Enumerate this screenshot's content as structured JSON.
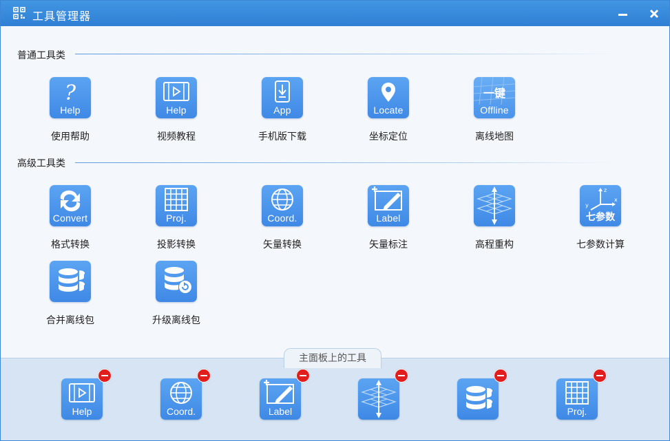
{
  "window": {
    "title": "工具管理器",
    "min_label": "–",
    "close_label": "✕"
  },
  "sections": {
    "common": {
      "title": "普通工具类"
    },
    "advanced": {
      "title": "高级工具类"
    }
  },
  "common_tools": [
    {
      "label": "使用帮助",
      "caption": "Help",
      "icon": "help-icon"
    },
    {
      "label": "视频教程",
      "caption": "Help",
      "icon": "video-icon"
    },
    {
      "label": "手机版下载",
      "caption": "App",
      "icon": "phone-download-icon"
    },
    {
      "label": "坐标定位",
      "caption": "Locate",
      "icon": "location-pin-icon"
    },
    {
      "label": "离线地图",
      "caption": "Offline",
      "icon": "offline-map-icon",
      "badge_text": "一键"
    }
  ],
  "advanced_tools": [
    {
      "label": "格式转换",
      "caption": "Convert",
      "icon": "convert-icon"
    },
    {
      "label": "投影转换",
      "caption": "Proj.",
      "icon": "projection-grid-icon"
    },
    {
      "label": "矢量转换",
      "caption": "Coord.",
      "icon": "globe-icon"
    },
    {
      "label": "矢量标注",
      "caption": "Label",
      "icon": "label-pen-icon"
    },
    {
      "label": "高程重构",
      "caption": "",
      "icon": "elevation-icon"
    },
    {
      "label": "七参数计算",
      "caption": "七参数",
      "icon": "seven-param-icon",
      "axis_x": "x",
      "axis_y": "y",
      "axis_z": "z"
    },
    {
      "label": "合并离线包",
      "caption": "",
      "icon": "merge-package-icon"
    },
    {
      "label": "升级离线包",
      "caption": "",
      "icon": "upgrade-package-icon"
    }
  ],
  "panel": {
    "title": "主面板上的工具"
  },
  "dock": [
    {
      "caption": "Help",
      "icon": "video-icon"
    },
    {
      "caption": "Coord.",
      "icon": "globe-icon"
    },
    {
      "caption": "Label",
      "icon": "label-pen-icon"
    },
    {
      "caption": "",
      "icon": "elevation-icon"
    },
    {
      "caption": "",
      "icon": "merge-package-icon"
    },
    {
      "caption": "Proj.",
      "icon": "projection-grid-icon"
    }
  ],
  "colors": {
    "titlebar": "#3a8bdc",
    "icon_bg": "#4a93ea",
    "remove_badge": "#e21d1d"
  }
}
